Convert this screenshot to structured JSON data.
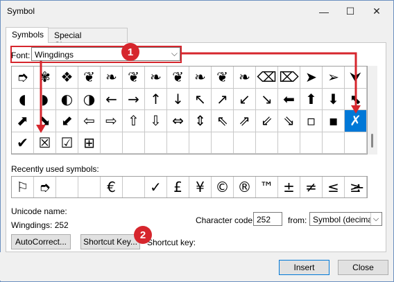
{
  "window": {
    "title": "Symbol",
    "minimize_icon": "—",
    "maximize_icon": "☐",
    "close_icon": "✕"
  },
  "tabs": [
    {
      "label": "Symbols",
      "active": true
    },
    {
      "label": "Special Characters",
      "active": false
    }
  ],
  "font": {
    "label": "Font:",
    "value": "Wingdings"
  },
  "grid": {
    "cells": [
      "➮",
      "✾",
      "❖",
      "❦",
      "❧",
      "❦",
      "❧",
      "❦",
      "❧",
      "❦",
      "❧",
      "⌫",
      "⌦",
      "➤",
      "➢",
      "⮟",
      "◖",
      "◗",
      "◐",
      "◑",
      "←",
      "→",
      "↑",
      "↓",
      "↖",
      "↗",
      "↙",
      "↘",
      "⬅",
      "⬆",
      "⬇",
      "⬉",
      "⬈",
      "⬊",
      "⬋",
      "⇦",
      "⇨",
      "⇧",
      "⇩",
      "⇔",
      "⇕",
      "⇖",
      "⇗",
      "⇙",
      "⇘",
      "▫",
      "▪",
      "✗",
      "✔",
      "☒",
      "☑",
      "⊞",
      "",
      "",
      "",
      "",
      "",
      "",
      "",
      "",
      "",
      "",
      "",
      ""
    ],
    "selected_index": 47
  },
  "recent": {
    "label": "Recently used symbols:",
    "symbols": [
      "⚐",
      "➮",
      "",
      "",
      "€",
      "",
      "✓",
      "£",
      "¥",
      "©",
      "®",
      "™",
      "±",
      "≠",
      "≤",
      "≥"
    ],
    "extra": "÷"
  },
  "unicode": {
    "name_label": "Unicode name:",
    "name_value": "Wingdings: 252"
  },
  "code": {
    "label": "Character code:",
    "value": "252"
  },
  "from": {
    "label": "from:",
    "value": "Symbol (decimal)"
  },
  "buttons": {
    "autocorrect": "AutoCorrect...",
    "shortcut_key": "Shortcut Key...",
    "insert": "Insert",
    "close": "Close"
  },
  "shortcut_key_text": "Shortcut key:",
  "annotations": [
    {
      "number": "1"
    },
    {
      "number": "2"
    }
  ],
  "colors": {
    "accent": "#0078d7",
    "annotation": "#d6262d"
  }
}
